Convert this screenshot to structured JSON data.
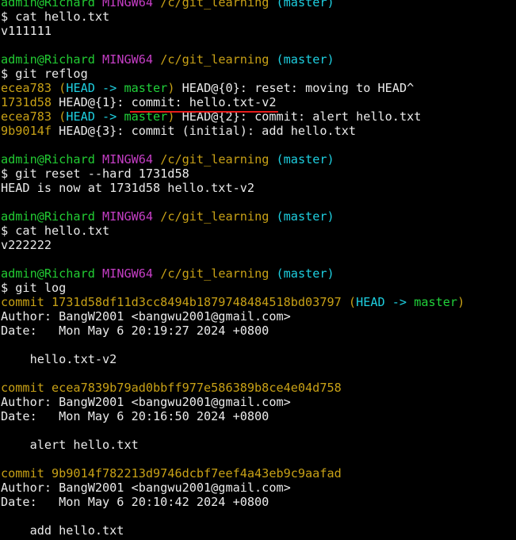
{
  "terminal": {
    "lines": [
      {
        "segments": [
          {
            "text": "admin@Richard",
            "color": "green"
          },
          {
            "text": " ",
            "color": "white"
          },
          {
            "text": "MINGW64",
            "color": "magenta"
          },
          {
            "text": " ",
            "color": "white"
          },
          {
            "text": "/c/git_learning",
            "color": "yellow"
          },
          {
            "text": " ",
            "color": "white"
          },
          {
            "text": "(master)",
            "color": "cyan"
          }
        ]
      },
      {
        "segments": [
          {
            "text": "$ cat hello.txt",
            "color": "white"
          }
        ]
      },
      {
        "segments": [
          {
            "text": "v111111",
            "color": "white"
          }
        ]
      },
      {
        "segments": [
          {
            "text": "",
            "color": "white"
          }
        ]
      },
      {
        "segments": [
          {
            "text": "admin@Richard",
            "color": "green"
          },
          {
            "text": " ",
            "color": "white"
          },
          {
            "text": "MINGW64",
            "color": "magenta"
          },
          {
            "text": " ",
            "color": "white"
          },
          {
            "text": "/c/git_learning",
            "color": "yellow"
          },
          {
            "text": " ",
            "color": "white"
          },
          {
            "text": "(master)",
            "color": "cyan"
          }
        ]
      },
      {
        "segments": [
          {
            "text": "$ git reflog",
            "color": "white"
          }
        ]
      },
      {
        "segments": [
          {
            "text": "ecea783",
            "color": "yellow"
          },
          {
            "text": " (",
            "color": "yellow"
          },
          {
            "text": "HEAD -> ",
            "color": "head"
          },
          {
            "text": "master",
            "color": "branch"
          },
          {
            "text": ")",
            "color": "yellow"
          },
          {
            "text": " HEAD@{0}: reset: moving to HEAD^",
            "color": "white"
          }
        ]
      },
      {
        "segments": [
          {
            "text": "1731d58",
            "color": "yellow"
          },
          {
            "text": " HEAD@{1}: ",
            "color": "white"
          },
          {
            "text": "commit: hello.txt-v2",
            "color": "white",
            "underline": true
          }
        ]
      },
      {
        "segments": [
          {
            "text": "ecea783",
            "color": "yellow"
          },
          {
            "text": " (",
            "color": "yellow"
          },
          {
            "text": "HEAD -> ",
            "color": "head"
          },
          {
            "text": "master",
            "color": "branch"
          },
          {
            "text": ")",
            "color": "yellow"
          },
          {
            "text": " HEAD@{2}: commit: alert hello.txt",
            "color": "white"
          }
        ]
      },
      {
        "segments": [
          {
            "text": "9b9014f",
            "color": "yellow"
          },
          {
            "text": " HEAD@{3}: commit (initial): add hello.txt",
            "color": "white"
          }
        ]
      },
      {
        "segments": [
          {
            "text": "",
            "color": "white"
          }
        ]
      },
      {
        "segments": [
          {
            "text": "admin@Richard",
            "color": "green"
          },
          {
            "text": " ",
            "color": "white"
          },
          {
            "text": "MINGW64",
            "color": "magenta"
          },
          {
            "text": " ",
            "color": "white"
          },
          {
            "text": "/c/git_learning",
            "color": "yellow"
          },
          {
            "text": " ",
            "color": "white"
          },
          {
            "text": "(master)",
            "color": "cyan"
          }
        ]
      },
      {
        "segments": [
          {
            "text": "$ git reset --hard 1731d58",
            "color": "white"
          }
        ]
      },
      {
        "segments": [
          {
            "text": "HEAD is now at 1731d58 hello.txt-v2",
            "color": "white"
          }
        ]
      },
      {
        "segments": [
          {
            "text": "",
            "color": "white"
          }
        ]
      },
      {
        "segments": [
          {
            "text": "admin@Richard",
            "color": "green"
          },
          {
            "text": " ",
            "color": "white"
          },
          {
            "text": "MINGW64",
            "color": "magenta"
          },
          {
            "text": " ",
            "color": "white"
          },
          {
            "text": "/c/git_learning",
            "color": "yellow"
          },
          {
            "text": " ",
            "color": "white"
          },
          {
            "text": "(master)",
            "color": "cyan"
          }
        ]
      },
      {
        "segments": [
          {
            "text": "$ cat hello.txt",
            "color": "white"
          }
        ]
      },
      {
        "segments": [
          {
            "text": "v222222",
            "color": "white"
          }
        ]
      },
      {
        "segments": [
          {
            "text": "",
            "color": "white"
          }
        ]
      },
      {
        "segments": [
          {
            "text": "admin@Richard",
            "color": "green"
          },
          {
            "text": " ",
            "color": "white"
          },
          {
            "text": "MINGW64",
            "color": "magenta"
          },
          {
            "text": " ",
            "color": "white"
          },
          {
            "text": "/c/git_learning",
            "color": "yellow"
          },
          {
            "text": " ",
            "color": "white"
          },
          {
            "text": "(master)",
            "color": "cyan"
          }
        ]
      },
      {
        "segments": [
          {
            "text": "$ git log",
            "color": "white"
          }
        ]
      },
      {
        "segments": [
          {
            "text": "commit 1731d58df11d3cc8494b1879748484518bd03797",
            "color": "yellow"
          },
          {
            "text": " (",
            "color": "yellow"
          },
          {
            "text": "HEAD -> ",
            "color": "head"
          },
          {
            "text": "master",
            "color": "branch"
          },
          {
            "text": ")",
            "color": "yellow"
          }
        ]
      },
      {
        "segments": [
          {
            "text": "Author: BangW2001 <bangwu2001@gmail.com>",
            "color": "white"
          }
        ]
      },
      {
        "segments": [
          {
            "text": "Date:   Mon May 6 20:19:27 2024 +0800",
            "color": "white"
          }
        ]
      },
      {
        "segments": [
          {
            "text": "",
            "color": "white"
          }
        ]
      },
      {
        "segments": [
          {
            "text": "    hello.txt-v2",
            "color": "white"
          }
        ]
      },
      {
        "segments": [
          {
            "text": "",
            "color": "white"
          }
        ]
      },
      {
        "segments": [
          {
            "text": "commit ecea7839b79ad0bbff977e586389b8ce4e04d758",
            "color": "yellow"
          }
        ]
      },
      {
        "segments": [
          {
            "text": "Author: BangW2001 <bangwu2001@gmail.com>",
            "color": "white"
          }
        ]
      },
      {
        "segments": [
          {
            "text": "Date:   Mon May 6 20:16:50 2024 +0800",
            "color": "white"
          }
        ]
      },
      {
        "segments": [
          {
            "text": "",
            "color": "white"
          }
        ]
      },
      {
        "segments": [
          {
            "text": "    alert hello.txt",
            "color": "white"
          }
        ]
      },
      {
        "segments": [
          {
            "text": "",
            "color": "white"
          }
        ]
      },
      {
        "segments": [
          {
            "text": "commit 9b9014f782213d9746dcbf7eef4a43eb9c9aafad",
            "color": "yellow"
          }
        ]
      },
      {
        "segments": [
          {
            "text": "Author: BangW2001 <bangwu2001@gmail.com>",
            "color": "white"
          }
        ]
      },
      {
        "segments": [
          {
            "text": "Date:   Mon May 6 20:10:42 2024 +0800",
            "color": "white"
          }
        ]
      },
      {
        "segments": [
          {
            "text": "",
            "color": "white"
          }
        ]
      },
      {
        "segments": [
          {
            "text": "    add hello.txt",
            "color": "white"
          }
        ]
      },
      {
        "segments": [
          {
            "text": "",
            "color": "white"
          }
        ]
      }
    ]
  },
  "colors": {
    "background": "#000000",
    "white": "#eaeaea",
    "green": "#22cc33",
    "magenta": "#c53ec5",
    "yellow": "#c8a116",
    "cyan": "#1ecfe0",
    "head": "#1ecfe0",
    "branch": "#21d13a",
    "annotation_underline": "#e81b1b"
  }
}
